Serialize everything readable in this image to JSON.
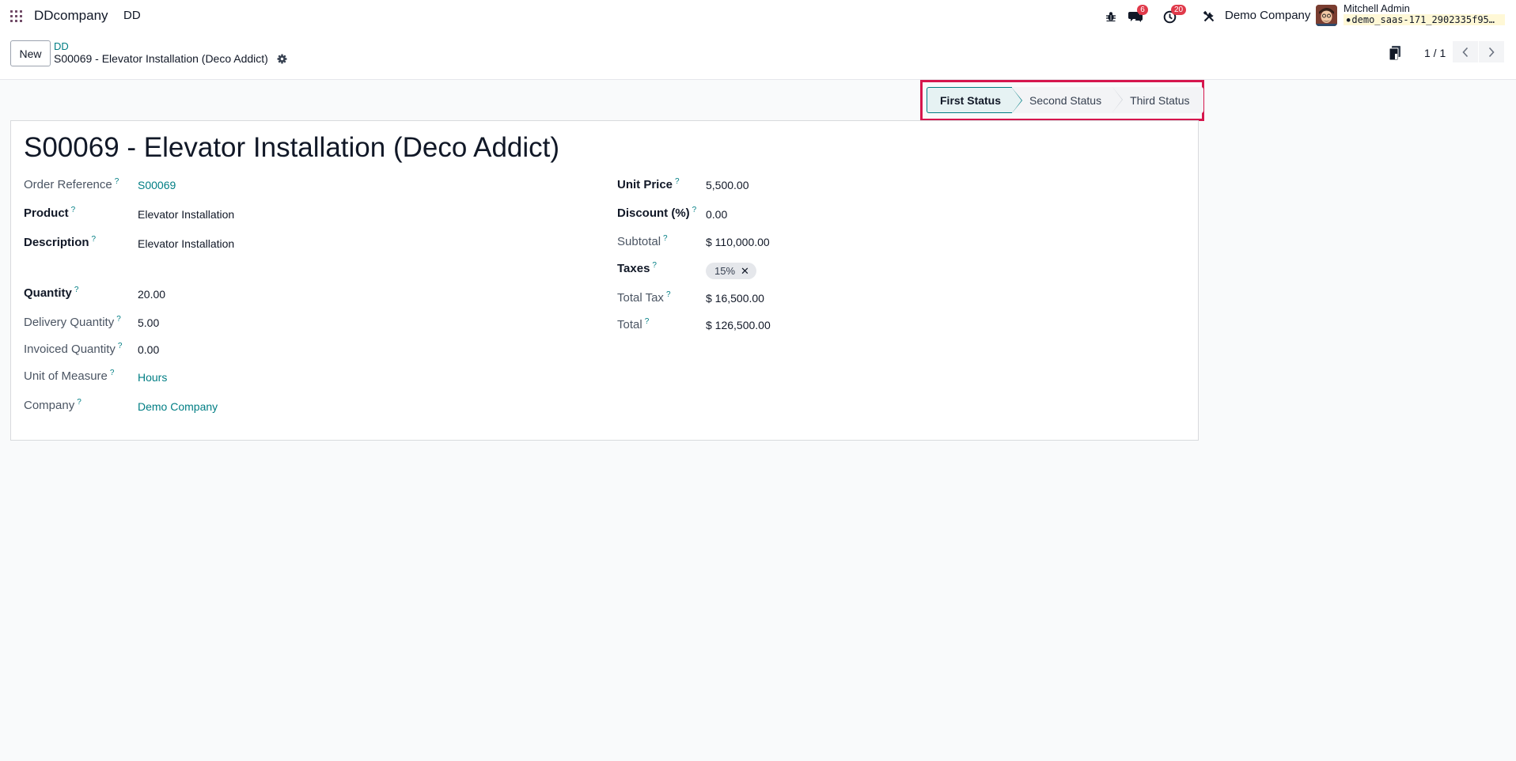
{
  "navbar": {
    "brand": "DDcompany",
    "menu_item": "DD",
    "messages_count": "6",
    "activities_count": "20",
    "company": "Demo Company",
    "user_name": "Mitchell Admin",
    "database": "demo_saas-171_2902335f95…"
  },
  "control_panel": {
    "new_label": "New",
    "breadcrumb_parent": "DD",
    "breadcrumb_current": "S00069 - Elevator Installation (Deco Addict)",
    "pager_value": "1 / 1"
  },
  "statusbar": {
    "steps": [
      "First Status",
      "Second Status",
      "Third Status"
    ],
    "active": "First Status"
  },
  "form": {
    "title": "S00069 - Elevator Installation (Deco Addict)",
    "help_mark": "?",
    "left": [
      {
        "label": "Order Reference",
        "value": "S00069"
      },
      {
        "label": "Product",
        "value": "Elevator Installation"
      },
      {
        "label": "Description",
        "value": "Elevator Installation"
      },
      {
        "label": "Quantity",
        "value": "20.00"
      },
      {
        "label": "Delivery Quantity",
        "value": "5.00"
      },
      {
        "label": "Invoiced Quantity",
        "value": "0.00"
      },
      {
        "label": "Unit of Measure",
        "value": "Hours"
      },
      {
        "label": "Company",
        "value": "Demo Company"
      }
    ],
    "right": [
      {
        "label": "Unit Price",
        "value": "5,500.00"
      },
      {
        "label": "Discount (%)",
        "value": "0.00"
      },
      {
        "label": "Subtotal",
        "value": "$ 110,000.00"
      },
      {
        "label": "Taxes",
        "value": "15%"
      },
      {
        "label": "Total Tax",
        "value": "$ 16,500.00"
      },
      {
        "label": "Total",
        "value": "$ 126,500.00"
      }
    ]
  },
  "colors": {
    "accent": "#017e84",
    "highlight": "#d6164d",
    "badge": "#e0394a"
  }
}
